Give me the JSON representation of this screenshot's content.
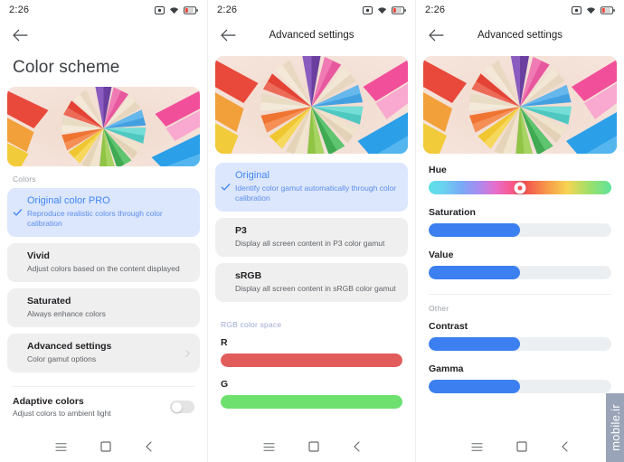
{
  "status": {
    "time": "2:26",
    "icons": [
      "screenshot-icon",
      "wifi-icon",
      "battery-low-icon"
    ],
    "battery_level_pct": 15
  },
  "colors": {
    "accent_blue": "#4285f4",
    "selected_card_bg": "#dce7fd",
    "card_bg": "#efefef",
    "track_bg": "#eceff1",
    "slider_red": "#e25c5c",
    "slider_green": "#6ee06e",
    "hue_thumb": "#f05159",
    "watermark_bg": "#9aa4b8"
  },
  "panel1": {
    "back_label": "Back",
    "page_title": "Color scheme",
    "image_alt": "colored-pencils-photo",
    "section_label": "Colors",
    "items": [
      {
        "title": "Original color PRO",
        "subtitle": "Reproduce realistic colors through color calibration",
        "selected": true
      },
      {
        "title": "Vivid",
        "subtitle": "Adjust colors based on the content displayed",
        "selected": false
      },
      {
        "title": "Saturated",
        "subtitle": "Always enhance colors",
        "selected": false
      },
      {
        "title": "Advanced settings",
        "subtitle": "Color gamut options",
        "selected": false,
        "chevron": true
      }
    ],
    "toggle": {
      "title": "Adaptive colors",
      "subtitle": "Adjust colors to ambient light",
      "state": "off"
    }
  },
  "panel2": {
    "back_label": "Back",
    "title": "Advanced settings",
    "image_alt": "colored-pencils-photo",
    "items": [
      {
        "title": "Original",
        "subtitle": "Identify color gamut automatically through color calibration",
        "selected": true
      },
      {
        "title": "P3",
        "subtitle": "Display all screen content in P3 color gamut",
        "selected": false
      },
      {
        "title": "sRGB",
        "subtitle": "Display all screen content in sRGB color gamut",
        "selected": false
      }
    ],
    "section_label": "RGB color space",
    "sliders": [
      {
        "label": "R",
        "value_pct": 100,
        "color": "#e25c5c"
      },
      {
        "label": "G",
        "value_pct": 100,
        "color": "#6ee06e"
      }
    ]
  },
  "panel3": {
    "back_label": "Back",
    "title": "Advanced settings",
    "image_alt": "colored-pencils-photo",
    "sliders_top": [
      {
        "label": "Hue",
        "value_pct": 50,
        "kind": "hue-gradient"
      },
      {
        "label": "Saturation",
        "value_pct": 50,
        "kind": "fill"
      },
      {
        "label": "Value",
        "value_pct": 50,
        "kind": "fill"
      }
    ],
    "section_label": "Other",
    "sliders_bottom": [
      {
        "label": "Contrast",
        "value_pct": 50,
        "kind": "fill"
      },
      {
        "label": "Gamma",
        "value_pct": 50,
        "kind": "fill"
      }
    ]
  },
  "navbar": {
    "items": [
      "menu-icon",
      "home-square-icon",
      "back-chevron-icon"
    ]
  },
  "watermark": {
    "text": "mobile.ir"
  }
}
